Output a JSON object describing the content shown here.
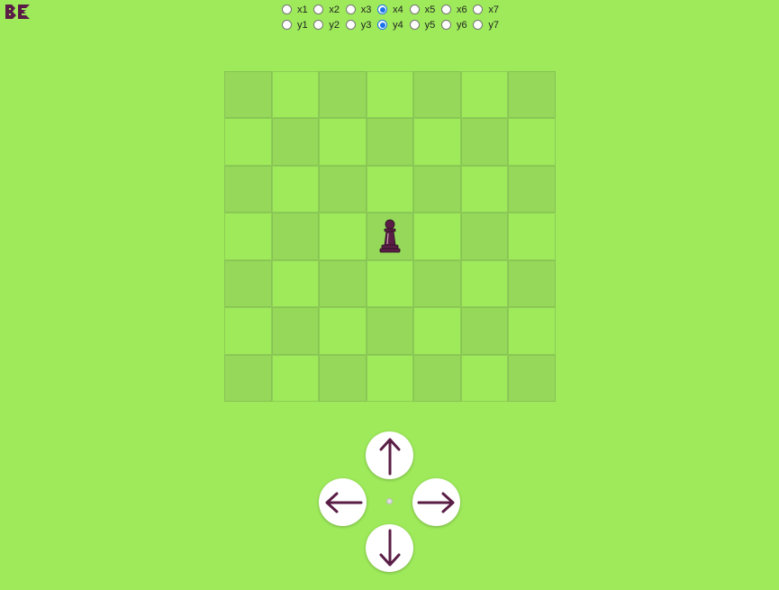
{
  "colors": {
    "background": "#9eea5b",
    "dark_square": "#95d85a",
    "light_square": "#9eea5b",
    "accent": "#5a1e46",
    "radio_selected": "#1a73e8"
  },
  "logo": {
    "icon": "be-logo-icon"
  },
  "x_options": [
    {
      "label": "x1",
      "checked": false
    },
    {
      "label": "x2",
      "checked": false
    },
    {
      "label": "x3",
      "checked": false
    },
    {
      "label": "x4",
      "checked": true
    },
    {
      "label": "x5",
      "checked": false
    },
    {
      "label": "x6",
      "checked": false
    },
    {
      "label": "x7",
      "checked": false
    }
  ],
  "y_options": [
    {
      "label": "y1",
      "checked": false
    },
    {
      "label": "y2",
      "checked": false
    },
    {
      "label": "y3",
      "checked": false
    },
    {
      "label": "y4",
      "checked": true
    },
    {
      "label": "y5",
      "checked": false
    },
    {
      "label": "y6",
      "checked": false
    },
    {
      "label": "y7",
      "checked": false
    }
  ],
  "board": {
    "columns": 7,
    "rows": 7,
    "piece": {
      "type": "pawn",
      "icon": "pawn-icon",
      "column": 4,
      "row": 4
    }
  },
  "controls": {
    "up": {
      "icon": "arrow-up-icon"
    },
    "left": {
      "icon": "arrow-left-icon"
    },
    "right": {
      "icon": "arrow-right-icon"
    },
    "down": {
      "icon": "arrow-down-icon"
    }
  }
}
